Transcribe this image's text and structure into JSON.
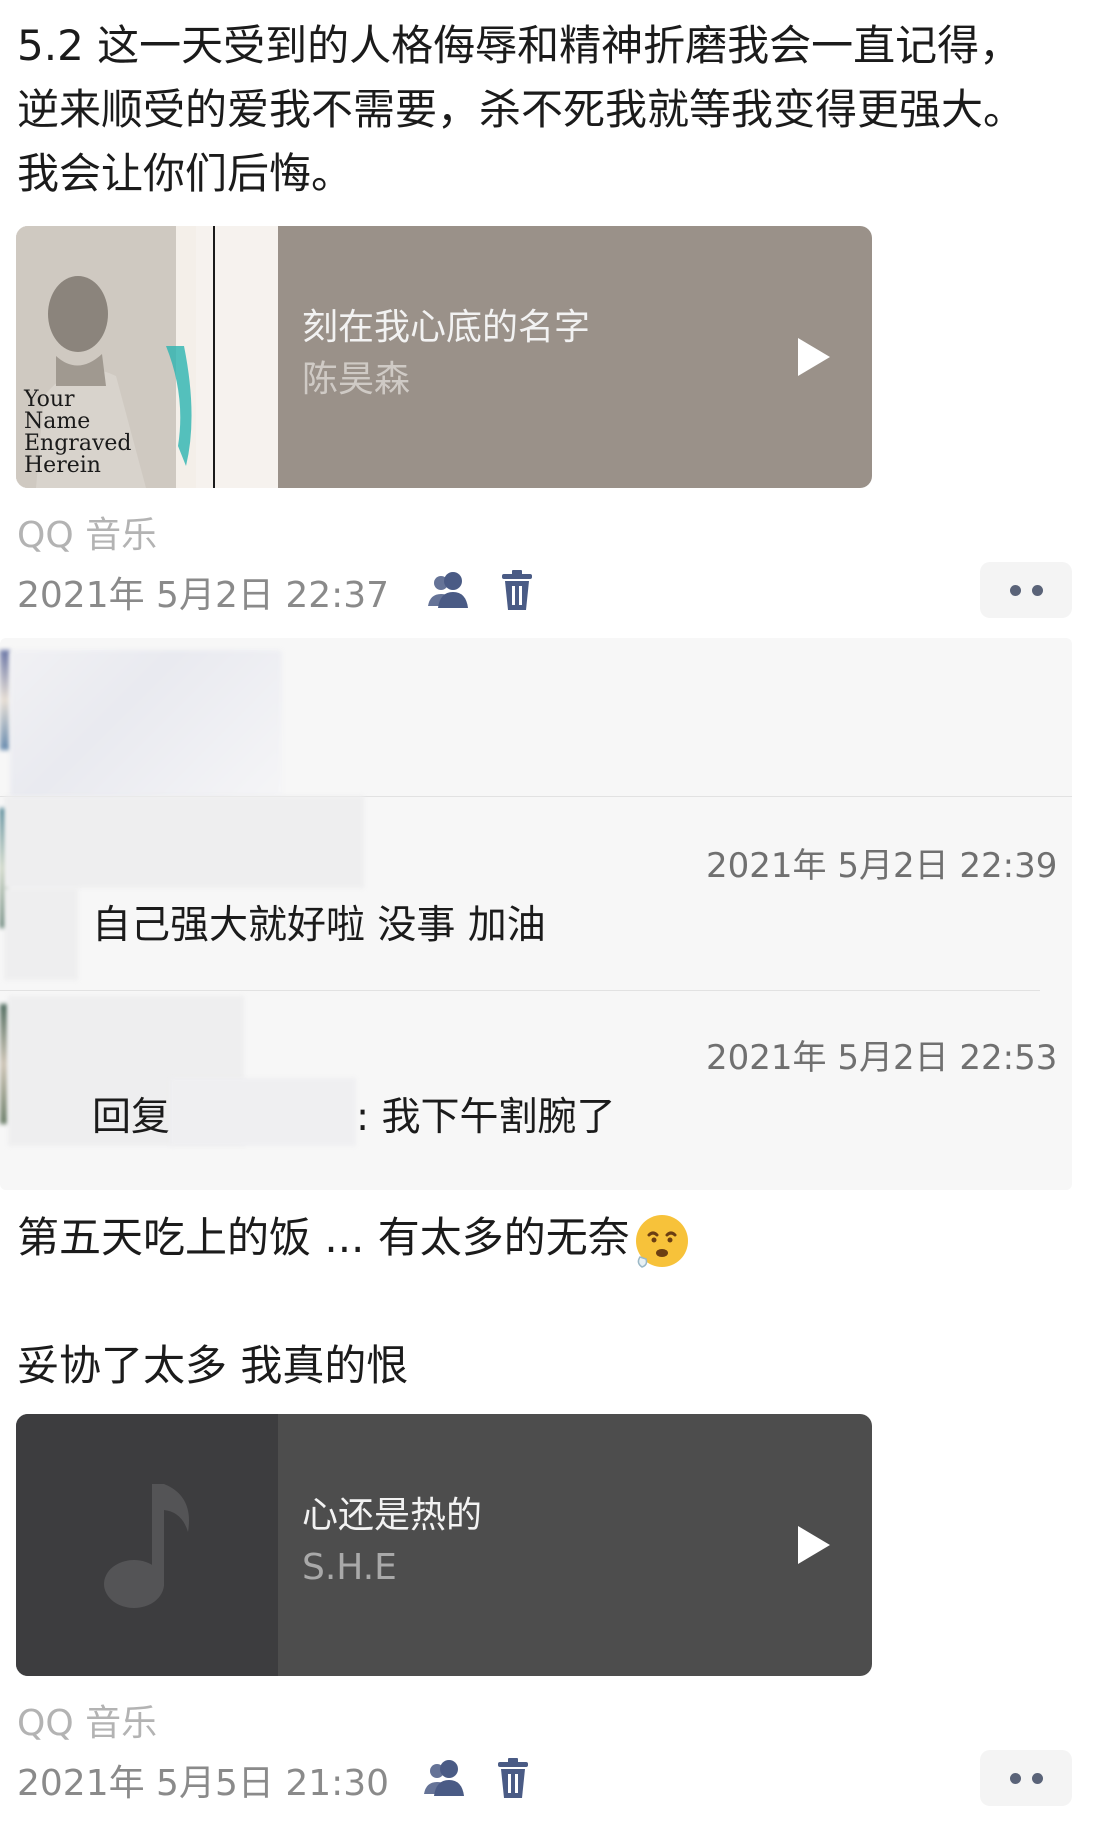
{
  "post1": {
    "text": "5.2  这一天受到的人格侮辱和精神折磨我会一直记得，逆来顺受的爱我不需要，杀不死我就等我变得更强大。我会让你们后悔。",
    "music": {
      "title": "刻在我心底的名字",
      "artist": "陈昊森",
      "cover_text": [
        "Your",
        "Name",
        "Engraved",
        "Herein"
      ],
      "cover_title_cn": "刻在我心底的名字"
    },
    "source": "QQ 音乐",
    "timestamp": "2021年 5月2日 22:37"
  },
  "comments": [
    {
      "time": "",
      "text": ""
    },
    {
      "time": "2021年 5月2日 22:39",
      "text": "自己强大就好啦  没事   加油"
    },
    {
      "time": "2021年 5月2日 22:53",
      "reply_prefix": "回复",
      "text": ": 我下午割腕了"
    }
  ],
  "post2": {
    "text_line1": "第五天吃上的饭 ... 有太多的无奈",
    "text_line2": "妥协了太多  我真的恨",
    "music": {
      "title": "心还是热的",
      "artist": "S.H.E"
    },
    "source": "QQ 音乐",
    "timestamp": "2021年 5月5日 21:30"
  },
  "icons": {
    "privacy": "friends-visibility-icon",
    "delete": "trash-icon",
    "more": "more-dots-icon",
    "note": "music-note-icon",
    "emoji": "worried-face-icon"
  },
  "colors": {
    "card1_bg": "#9a9189",
    "card2_bg": "#4d4d4d",
    "accent_icon": "#4a5b85"
  }
}
